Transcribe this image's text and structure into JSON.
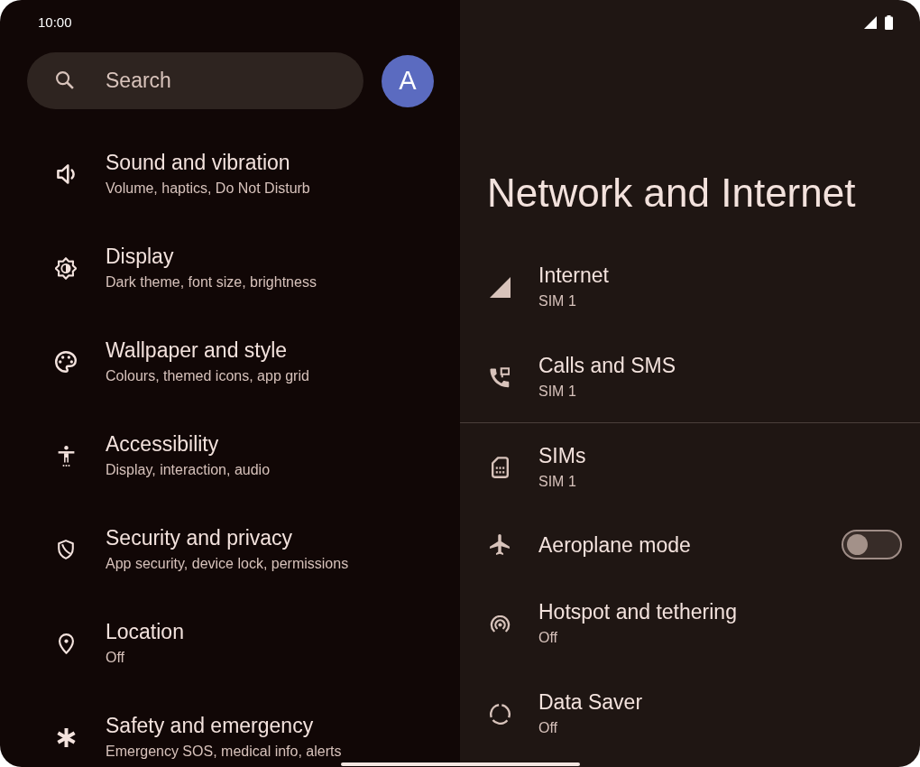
{
  "status_bar": {
    "time": "10:00"
  },
  "search": {
    "placeholder": "Search"
  },
  "account": {
    "initial": "A"
  },
  "settings": [
    {
      "title": "Sound and vibration",
      "subtitle": "Volume, haptics, Do Not Disturb"
    },
    {
      "title": "Display",
      "subtitle": "Dark theme, font size, brightness"
    },
    {
      "title": "Wallpaper and style",
      "subtitle": "Colours, themed icons, app grid"
    },
    {
      "title": "Accessibility",
      "subtitle": "Display, interaction, audio"
    },
    {
      "title": "Security and privacy",
      "subtitle": "App security, device lock, permissions"
    },
    {
      "title": "Location",
      "subtitle": "Off"
    },
    {
      "title": "Safety and emergency",
      "subtitle": "Emergency SOS, medical info, alerts"
    }
  ],
  "detail": {
    "title": "Network and Internet",
    "sections": [
      {
        "items": [
          {
            "kind": "link",
            "title": "Internet",
            "subtitle": "SIM 1"
          },
          {
            "kind": "link",
            "title": "Calls and SMS",
            "subtitle": "SIM 1"
          }
        ]
      },
      {
        "items": [
          {
            "kind": "link",
            "title": "SIMs",
            "subtitle": "SIM 1"
          },
          {
            "kind": "toggle",
            "title": "Aeroplane mode",
            "on": false
          },
          {
            "kind": "link",
            "title": "Hotspot and tethering",
            "subtitle": "Off"
          },
          {
            "kind": "link",
            "title": "Data Saver",
            "subtitle": "Off"
          }
        ]
      }
    ]
  }
}
